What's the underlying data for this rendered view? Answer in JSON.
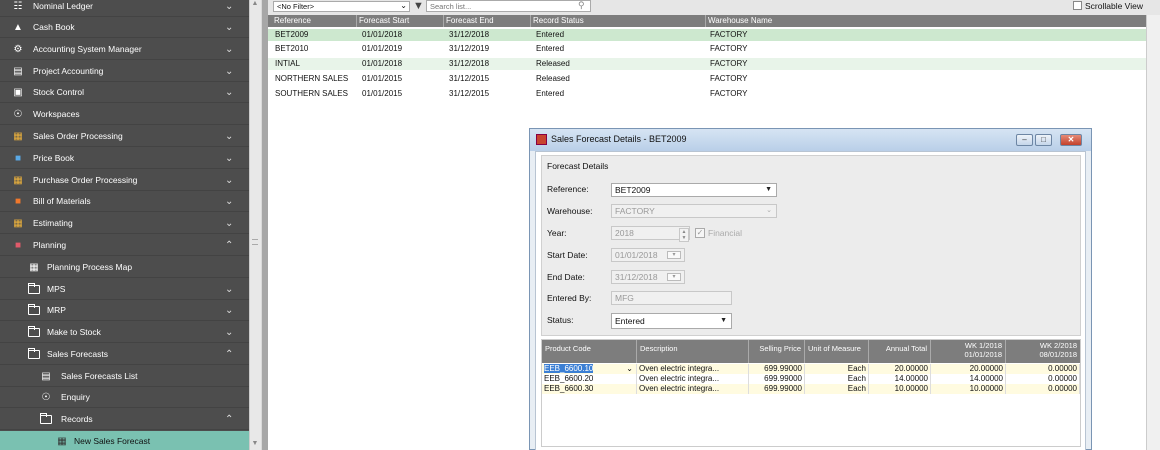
{
  "sidebar": {
    "items": [
      {
        "label": "Nominal Ledger",
        "icon": "ledger-icon"
      },
      {
        "label": "Cash Book",
        "icon": "bank-icon"
      },
      {
        "label": "Accounting System Manager",
        "icon": "settings-icon"
      },
      {
        "label": "Project Accounting",
        "icon": "clipboard-icon"
      },
      {
        "label": "Stock Control",
        "icon": "boxes-icon"
      },
      {
        "label": "Workspaces",
        "icon": "globe-icon"
      },
      {
        "label": "Sales Order Processing",
        "icon": "sales-order-icon"
      },
      {
        "label": "Price Book",
        "icon": "price-book-icon"
      },
      {
        "label": "Purchase Order Processing",
        "icon": "purchase-order-icon"
      },
      {
        "label": "Bill of Materials",
        "icon": "bom-icon"
      },
      {
        "label": "Estimating",
        "icon": "estimating-icon"
      },
      {
        "label": "Planning",
        "icon": "planning-icon"
      },
      {
        "label": "Planning Process Map",
        "icon": "process-map-icon"
      },
      {
        "label": "MPS",
        "icon": "folder-icon"
      },
      {
        "label": "MRP",
        "icon": "folder-icon"
      },
      {
        "label": "Make to Stock",
        "icon": "folder-icon"
      },
      {
        "label": "Sales Forecasts",
        "icon": "folder-icon"
      },
      {
        "label": "Sales Forecasts List",
        "icon": "list-icon"
      },
      {
        "label": "Enquiry",
        "icon": "globe-icon"
      },
      {
        "label": "Records",
        "icon": "folder-icon"
      },
      {
        "label": "New Sales Forecast",
        "icon": "grid-icon"
      }
    ]
  },
  "toolbar": {
    "filter_value": "<No Filter>",
    "search_placeholder": "Search list...",
    "scrollable_view_label": "Scrollable View"
  },
  "list": {
    "columns": [
      "Reference",
      "Forecast Start",
      "Forecast End",
      "Record Status",
      "Warehouse Name"
    ],
    "rows": [
      [
        "BET2009",
        "01/01/2018",
        "31/12/2018",
        "Entered",
        "FACTORY"
      ],
      [
        "BET2010",
        "01/01/2019",
        "31/12/2019",
        "Entered",
        "FACTORY"
      ],
      [
        "INTIAL",
        "01/01/2018",
        "31/12/2018",
        "Released",
        "FACTORY"
      ],
      [
        "NORTHERN SALES",
        "01/01/2015",
        "31/12/2015",
        "Released",
        "FACTORY"
      ],
      [
        "SOUTHERN SALES",
        "01/01/2015",
        "31/12/2015",
        "Entered",
        "FACTORY"
      ]
    ]
  },
  "dialog": {
    "title": "Sales Forecast Details - BET2009",
    "panel_title": "Forecast Details",
    "fields": {
      "reference_label": "Reference:",
      "reference_value": "BET2009",
      "warehouse_label": "Warehouse:",
      "warehouse_value": "FACTORY",
      "year_label": "Year:",
      "year_value": "2018",
      "financial_label": "Financial",
      "start_label": "Start Date:",
      "start_value": "01/01/2018",
      "end_label": "End Date:",
      "end_value": "31/12/2018",
      "entered_by_label": "Entered By:",
      "entered_by_value": "MFG",
      "status_label": "Status:",
      "status_value": "Entered"
    },
    "grid": {
      "columns": {
        "code": "Product Code",
        "desc": "Description",
        "price": "Selling Price",
        "uom": "Unit of Measure",
        "annual": "Annual Total",
        "wk1": "WK 1/2018",
        "wk1_date": "01/01/2018",
        "wk2": "WK 2/2018",
        "wk2_date": "08/01/2018"
      },
      "rows": [
        [
          "EEB_6600.10",
          "Oven electric integra...",
          "699.99000",
          "Each",
          "20.00000",
          "20.00000",
          "0.00000"
        ],
        [
          "EEB_6600.20",
          "Oven electric integra...",
          "699.99000",
          "Each",
          "14.00000",
          "14.00000",
          "0.00000"
        ],
        [
          "EEB_6600.30",
          "Oven electric integra...",
          "699.99000",
          "Each",
          "10.00000",
          "10.00000",
          "0.00000"
        ]
      ]
    }
  }
}
